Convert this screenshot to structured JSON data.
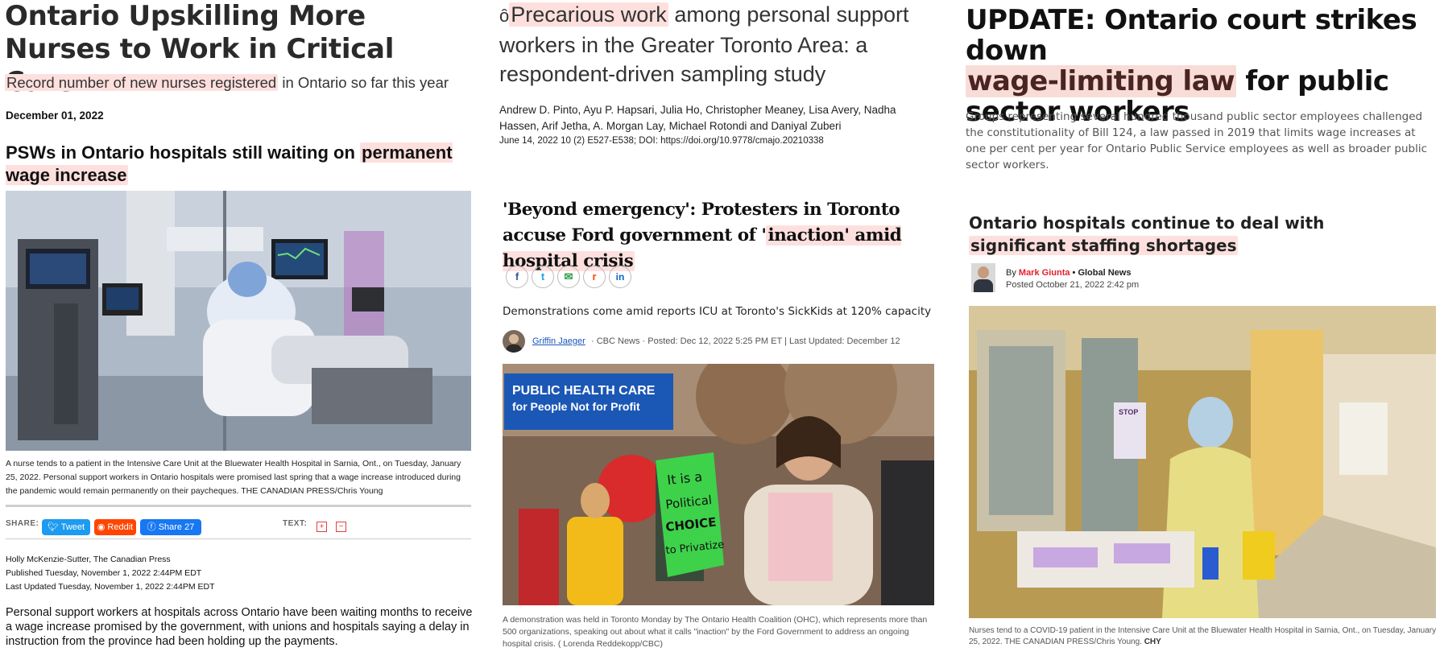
{
  "col1": {
    "title": "Ontario Upskilling More Nurses to Work in Critical Care",
    "subtitle_highlight": "Record number of new nurses registered",
    "subtitle_rest": " in Ontario so far this year",
    "date": "December 01, 2022",
    "headline_plain": "PSWs in Ontario hospitals still waiting on ",
    "headline_highlight": "permanent wage increase",
    "caption": "A nurse tends to a patient in the Intensive Care Unit at the Bluewater Health Hospital in Sarnia, Ont., on Tuesday, January 25, 2022. Personal support workers in Ontario hospitals were promised last spring that a wage increase introduced during the pandemic would remain permanently on their paycheques. THE CANADIAN PRESS/Chris Young",
    "share_label": "SHARE:",
    "tweet_label": "Tweet",
    "reddit_label": "Reddit",
    "fb_label": "Share",
    "fb_count": "27",
    "text_label": "TEXT:",
    "text_plus": "+",
    "text_minus": "−",
    "byline_author": "Holly McKenzie-Sutter, The Canadian Press",
    "byline_published": "Published Tuesday, November 1, 2022 2:44PM EDT",
    "byline_updated": "Last Updated Tuesday, November 1, 2022 2:44PM EDT",
    "body": "Personal support workers at hospitals across Ontario have been waiting months to receive a wage increase promised by the government, with unions and hospitals saying a delay in instruction from the province had been holding up the payments."
  },
  "col2": {
    "open_access_icon": "ȏ",
    "title_highlight": "Precarious work",
    "title_rest": " among personal support workers in the Greater Toronto Area: a respondent-driven sampling study",
    "authors": "Andrew D. Pinto, Ayu P. Hapsari, Julia Ho, Christopher Meaney, Lisa Avery, Nadha Hassen, Arif Jetha, A. Morgan Lay, Michael Rotondi and Daniyal Zuberi",
    "citation": "June 14, 2022 10 (2) E527-E538; DOI: https://doi.org/10.9778/cmajo.20210338",
    "headline_plain": "'Beyond emergency': Protesters in Toronto accuse Ford government of '",
    "headline_highlight": "inaction' amid hospital crisis",
    "social": [
      "f",
      "t",
      "✉",
      "r",
      "in"
    ],
    "dek": "Demonstrations come amid reports ICU at Toronto's SickKids at 120% capacity",
    "author_name": "Griffin Jaeger",
    "meta_rest": " · CBC News · Posted: Dec 12, 2022 5:25 PM ET | Last Updated: December 12",
    "sign1_line1": "PUBLIC HEALTH CARE",
    "sign1_line2": "for People Not for Profit",
    "sign2_line1": "It is a",
    "sign2_line2": "Political",
    "sign2_line3": "CHOICE",
    "sign2_line4": "to Privatize",
    "caption": "A demonstration was held in Toronto Monday by The Ontario Health Coalition (OHC), which represents more than 500 organizations, speaking out about what it calls \"inaction\" by the Ford Government to address an ongoing hospital crisis. ( Lorenda Reddekopp/CBC)"
  },
  "col3": {
    "title_line1": "UPDATE: Ontario court strikes down",
    "title_highlight": "wage-limiting law",
    "title_rest": " for public sector workers",
    "body": "Groups representing several hundred thousand public sector employees challenged the constitutionality of Bill 124, a law passed in 2019 that limits wage increases at one per cent per year for Ontario Public Service employees as well as broader public sector workers.",
    "headline_plain": "Ontario hospitals continue to deal with ",
    "headline_highlight": "significant staffing shortages",
    "by_label": "By ",
    "author_name": "Mark Giunta",
    "outlet": " • Global News",
    "posted": "Posted October 21, 2022 2:42 pm",
    "stop_sign": "STOP",
    "caption": "Nurses tend to a COVID-19 patient in the Intensive Care Unit at the Bluewater Health Hospital in Sarnia, Ont., on Tuesday, January 25, 2022. THE CANADIAN PRESS/Chris Young.",
    "caption_tag": "CHY"
  },
  "colors": {
    "highlight": "#fde0de",
    "twitter": "#1d9bf0",
    "reddit": "#ff4500",
    "facebook": "#1877f2",
    "global_red": "#e4202e"
  }
}
